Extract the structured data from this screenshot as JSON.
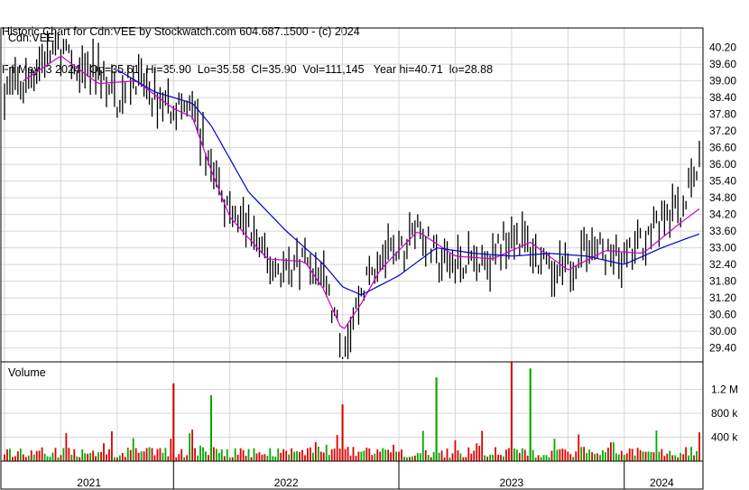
{
  "header": {
    "line1": "Historic Chart for Cdn:VEE by Stockwatch.com 604.687.1500 - (c) 2024",
    "line2": "Fri May  3 2024   Op=35.61  Hi=35.90  Lo=35.58  Cl=35.90  Vol=111,145   Year hi=40.71  lo=28.88"
  },
  "chart_data": [
    {
      "type": "line",
      "title": "Cdn:VEE",
      "ylim": [
        28.9,
        40.9
      ],
      "y_ticks": [
        "40.20",
        "39.60",
        "39.00",
        "38.40",
        "37.80",
        "37.20",
        "36.60",
        "36.00",
        "35.40",
        "34.80",
        "34.20",
        "33.60",
        "33.00",
        "32.40",
        "31.80",
        "31.20",
        "30.60",
        "30.00",
        "29.40"
      ],
      "x_range": [
        "2021-04",
        "2024-05"
      ],
      "x_labels": [
        "2021",
        "2022",
        "2023",
        "2024"
      ],
      "grid": true,
      "series": [
        {
          "style": "high-low price bars",
          "color": "#000000",
          "points": [
            [
              "2021-05",
              38.8
            ],
            [
              "2021-06",
              39.8
            ],
            [
              "2021-07",
              40.2
            ],
            [
              "2021-08",
              39.0
            ],
            [
              "2021-09",
              39.4
            ],
            [
              "2021-10",
              38.3
            ],
            [
              "2021-11",
              39.2
            ],
            [
              "2021-12",
              38.4
            ],
            [
              "2022-01",
              38.2
            ],
            [
              "2022-02",
              37.8
            ],
            [
              "2022-03",
              36.0
            ],
            [
              "2022-04",
              34.0
            ],
            [
              "2022-05",
              33.8
            ],
            [
              "2022-06",
              32.4
            ],
            [
              "2022-07",
              32.2
            ],
            [
              "2022-08",
              32.7
            ],
            [
              "2022-09",
              31.8
            ],
            [
              "2022-10",
              29.4
            ],
            [
              "2022-11",
              31.4
            ],
            [
              "2022-12",
              32.8
            ],
            [
              "2023-01",
              32.6
            ],
            [
              "2023-02",
              33.9
            ],
            [
              "2023-03",
              32.5
            ],
            [
              "2023-04",
              32.5
            ],
            [
              "2023-05",
              32.6
            ],
            [
              "2023-06",
              32.6
            ],
            [
              "2023-07",
              33.7
            ],
            [
              "2023-08",
              33.0
            ],
            [
              "2023-09",
              32.0
            ],
            [
              "2023-10",
              32.2
            ],
            [
              "2023-11",
              33.2
            ],
            [
              "2023-12",
              32.8
            ],
            [
              "2024-01",
              32.4
            ],
            [
              "2024-02",
              33.3
            ],
            [
              "2024-03",
              33.9
            ],
            [
              "2024-04",
              34.4
            ],
            [
              "2024-05",
              35.9
            ]
          ]
        },
        {
          "style": "short moving average",
          "color": "#cc00cc",
          "points": [
            [
              "2021-05",
              39.0
            ],
            [
              "2021-07",
              39.9
            ],
            [
              "2021-09",
              38.9
            ],
            [
              "2021-11",
              39.0
            ],
            [
              "2022-01",
              38.0
            ],
            [
              "2022-02",
              37.7
            ],
            [
              "2022-03",
              35.8
            ],
            [
              "2022-04",
              34.1
            ],
            [
              "2022-06",
              32.6
            ],
            [
              "2022-08",
              32.5
            ],
            [
              "2022-09",
              31.5
            ],
            [
              "2022-10",
              30.0
            ],
            [
              "2022-11",
              31.0
            ],
            [
              "2022-12",
              32.2
            ],
            [
              "2023-02",
              33.6
            ],
            [
              "2023-04",
              32.7
            ],
            [
              "2023-06",
              32.6
            ],
            [
              "2023-08",
              33.2
            ],
            [
              "2023-10",
              32.2
            ],
            [
              "2023-12",
              32.9
            ],
            [
              "2024-02",
              32.8
            ],
            [
              "2024-04",
              33.9
            ],
            [
              "2024-05",
              34.4
            ]
          ]
        },
        {
          "style": "long moving average",
          "color": "#0000cc",
          "points": [
            [
              "2021-10",
              39.4
            ],
            [
              "2021-12",
              38.6
            ],
            [
              "2022-02",
              38.2
            ],
            [
              "2022-03",
              37.4
            ],
            [
              "2022-05",
              35.0
            ],
            [
              "2022-07",
              33.6
            ],
            [
              "2022-09",
              32.4
            ],
            [
              "2022-10",
              31.6
            ],
            [
              "2022-11",
              31.3
            ],
            [
              "2023-01",
              32.0
            ],
            [
              "2023-03",
              33.0
            ],
            [
              "2023-05",
              32.8
            ],
            [
              "2023-07",
              32.7
            ],
            [
              "2023-09",
              32.8
            ],
            [
              "2023-11",
              32.7
            ],
            [
              "2024-01",
              32.4
            ],
            [
              "2024-03",
              33.0
            ],
            [
              "2024-05",
              33.5
            ]
          ]
        }
      ]
    },
    {
      "type": "bar",
      "title": "Volume",
      "ylim": [
        0,
        1600000
      ],
      "y_ticks": [
        "1.2 M",
        "800 k",
        "400 k"
      ],
      "bar_colors": {
        "up": "#00aa00",
        "down": "#dd0000"
      },
      "notable_values": [
        [
          "2022-01",
          1300000
        ],
        [
          "2022-03",
          1100000
        ],
        [
          "2022-10",
          950000
        ],
        [
          "2023-03",
          1400000
        ],
        [
          "2023-07",
          1650000
        ],
        [
          "2023-08",
          1550000
        ]
      ]
    }
  ]
}
